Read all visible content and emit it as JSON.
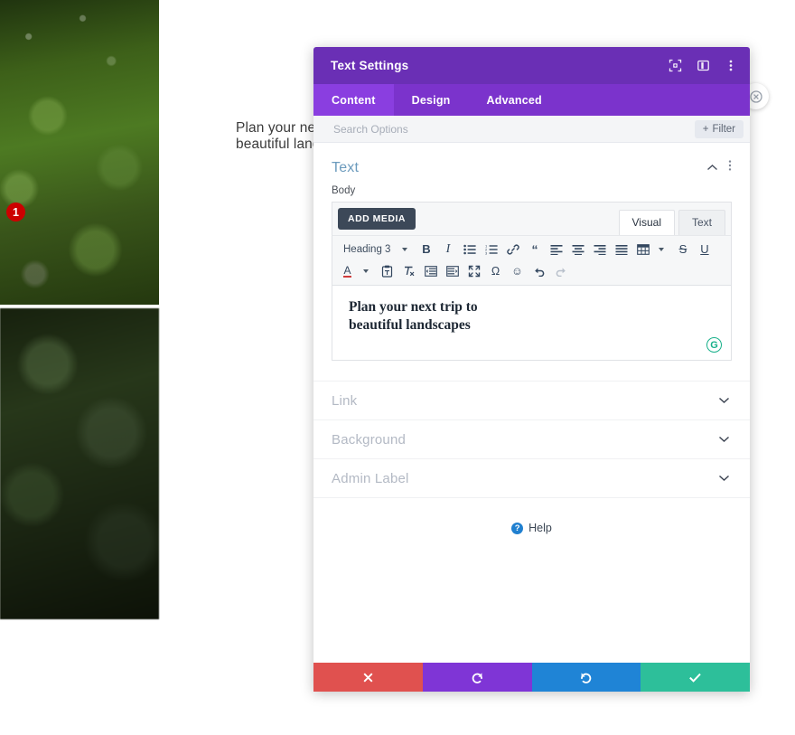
{
  "background_page": {
    "heading": "Plan your next trip to\nbeautiful landscapes",
    "photos": [
      {
        "name": "green-foliage-bright"
      },
      {
        "name": "green-foliage-dark"
      }
    ]
  },
  "floating_close": {
    "icon": "close-circle-icon"
  },
  "modal": {
    "title": "Text Settings",
    "header_icons": [
      {
        "name": "focus-expand-icon"
      },
      {
        "name": "panel-layout-icon"
      },
      {
        "name": "more-vertical-icon"
      }
    ],
    "tabs": [
      {
        "label": "Content",
        "active": true
      },
      {
        "label": "Design",
        "active": false
      },
      {
        "label": "Advanced",
        "active": false
      }
    ],
    "search": {
      "placeholder": "Search Options",
      "value": ""
    },
    "filter_button": {
      "label": "Filter",
      "icon": "plus-icon"
    },
    "open_section": {
      "title": "Text",
      "collapse_icon": "chevron-up-icon",
      "menu_icon": "more-vertical-icon",
      "field_label": "Body",
      "add_media_label": "ADD MEDIA",
      "editor_tabs": [
        {
          "label": "Visual",
          "active": true
        },
        {
          "label": "Text",
          "active": false
        }
      ],
      "toolbar_row1": [
        {
          "name": "format-select",
          "label": "Heading 3",
          "type": "select"
        },
        {
          "name": "format-select-caret",
          "label": "",
          "type": "caret"
        },
        {
          "name": "bold-icon",
          "label": "B",
          "type": "bold"
        },
        {
          "name": "italic-icon",
          "label": "I",
          "type": "italic"
        },
        {
          "name": "bullet-list-icon",
          "label": "",
          "type": "ul"
        },
        {
          "name": "numbered-list-icon",
          "label": "",
          "type": "ol"
        },
        {
          "name": "link-icon",
          "label": "",
          "type": "link"
        },
        {
          "name": "blockquote-icon",
          "label": "",
          "type": "quote"
        },
        {
          "name": "align-left-icon",
          "label": "",
          "type": "alignleft"
        },
        {
          "name": "align-center-icon",
          "label": "",
          "type": "aligncenter"
        },
        {
          "name": "align-right-icon",
          "label": "",
          "type": "alignright"
        },
        {
          "name": "align-justify-icon",
          "label": "",
          "type": "alignjustify"
        },
        {
          "name": "table-icon",
          "label": "",
          "type": "table"
        },
        {
          "name": "table-caret",
          "label": "",
          "type": "caret"
        },
        {
          "name": "strikethrough-icon",
          "label": "S",
          "type": "strike"
        },
        {
          "name": "underline-icon",
          "label": "U",
          "type": "underline"
        }
      ],
      "toolbar_row2": [
        {
          "name": "text-color-icon",
          "label": "A",
          "type": "textcolor"
        },
        {
          "name": "text-color-caret",
          "label": "",
          "type": "caret"
        },
        {
          "name": "paste-as-text-icon",
          "label": "",
          "type": "paste"
        },
        {
          "name": "clear-formatting-icon",
          "label": "",
          "type": "clearfmt"
        },
        {
          "name": "outdent-icon",
          "label": "",
          "type": "outdent"
        },
        {
          "name": "indent-icon",
          "label": "",
          "type": "indent"
        },
        {
          "name": "fullscreen-icon",
          "label": "",
          "type": "fullscreen"
        },
        {
          "name": "special-character-icon",
          "label": "Ω",
          "type": "omega"
        },
        {
          "name": "emoji-icon",
          "label": "☺",
          "type": "emoji"
        },
        {
          "name": "undo-icon",
          "label": "",
          "type": "undo"
        },
        {
          "name": "redo-icon",
          "label": "",
          "type": "redo",
          "disabled": true
        }
      ],
      "editor_content": "Plan your next trip to\nbeautiful landscapes",
      "grammarly_badge": "G"
    },
    "step_badge": "1",
    "closed_sections": [
      {
        "title": "Link",
        "icon": "chevron-down-icon"
      },
      {
        "title": "Background",
        "icon": "chevron-down-icon"
      },
      {
        "title": "Admin Label",
        "icon": "chevron-down-icon"
      }
    ],
    "help": {
      "label": "Help",
      "icon": "question-mark-icon"
    },
    "footer_buttons": [
      {
        "name": "discard-button",
        "icon": "x-icon",
        "color": "#e0514f"
      },
      {
        "name": "undo-button",
        "icon": "undo-arrow-icon",
        "color": "#7f35d6"
      },
      {
        "name": "redo-button",
        "icon": "redo-arrow-icon",
        "color": "#1f84d6"
      },
      {
        "name": "save-button",
        "icon": "checkmark-icon",
        "color": "#2dbf9a"
      }
    ]
  }
}
